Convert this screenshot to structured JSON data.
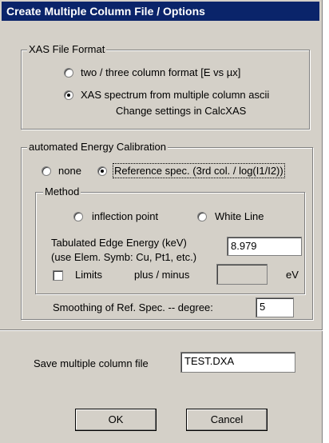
{
  "window": {
    "title": "Create Multiple Column File / Options"
  },
  "xas_format": {
    "legend": "XAS File Format",
    "option_two_three": "two / three column format [E vs µx]",
    "option_multi": "XAS spectrum from multiple column ascii",
    "note": "Change settings in CalcXAS",
    "selected": "multi"
  },
  "energy_calibration": {
    "legend": "automated Energy Calibration",
    "option_none": "none",
    "option_reference": "Reference spec. (3rd col. / log(I1/I2))",
    "selected": "reference",
    "method": {
      "legend": "Method",
      "option_inflection": "inflection point",
      "option_white_line": "White Line",
      "edge_label_line1": "Tabulated Edge Energy (keV)",
      "edge_label_line2": "(use Elem. Symb: Cu, Pt1, etc.)",
      "edge_value": "8.979",
      "limits_label": "Limits",
      "limits_checked": false,
      "plus_minus_label": "plus / minus",
      "plus_minus_value": "",
      "unit": "eV"
    },
    "smoothing_label": "Smoothing of Ref. Spec. -- degree:",
    "smoothing_value": "5"
  },
  "save": {
    "label": "Save multiple column file",
    "value": "TEST.DXA"
  },
  "buttons": {
    "ok": "OK",
    "cancel": "Cancel"
  }
}
